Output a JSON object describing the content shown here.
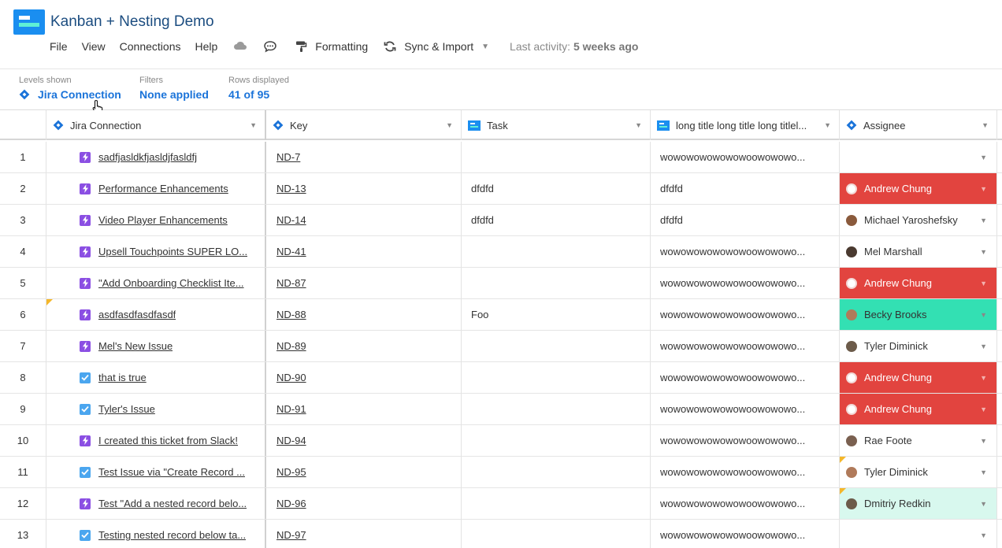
{
  "app": {
    "title": "Kanban + Nesting Demo",
    "brand_color": "#1a8ef0"
  },
  "menu": {
    "items": [
      {
        "label": "File"
      },
      {
        "label": "View"
      },
      {
        "label": "Connections"
      },
      {
        "label": "Help"
      }
    ],
    "icons": [
      "cloud-icon",
      "chat-icon"
    ],
    "formatting_label": "Formatting",
    "sync_label": "Sync & Import",
    "last_activity_label": "Last activity:",
    "last_activity_value": "5 weeks ago"
  },
  "levels": {
    "levels_caption": "Levels shown",
    "levels_value": "Jira Connection",
    "filters_caption": "Filters",
    "filters_value": "None applied",
    "rows_caption": "Rows displayed",
    "rows_value": "41 of 95"
  },
  "columns": [
    {
      "label": "Jira Connection",
      "icon": "jira-diamond-icon"
    },
    {
      "label": "Key",
      "icon": "jira-diamond-icon"
    },
    {
      "label": "Task",
      "icon": "sheet-icon"
    },
    {
      "label": "long title long title long titlel...",
      "icon": "sheet-icon"
    },
    {
      "label": "Assignee",
      "icon": "jira-diamond-icon"
    }
  ],
  "rows": [
    {
      "num": "1",
      "type": "epic",
      "title": "sadfjasldkfjasldjfasldfj",
      "key": "ND-7",
      "task": "",
      "long": "wowowowowowowoowowowo...",
      "assignee": "",
      "style": "",
      "flag_jira": false,
      "flag_assign": false
    },
    {
      "num": "2",
      "type": "epic",
      "title": "Performance Enhancements",
      "key": "ND-13",
      "task": "dfdfd",
      "long": "dfdfd",
      "assignee": "Andrew Chung",
      "style": "red",
      "flag_jira": false,
      "flag_assign": false
    },
    {
      "num": "3",
      "type": "epic",
      "title": "Video Player Enhancements",
      "key": "ND-14",
      "task": "dfdfd",
      "long": "dfdfd",
      "assignee": "Michael Yaroshefsky",
      "style": "",
      "flag_jira": false,
      "flag_assign": false
    },
    {
      "num": "4",
      "type": "epic",
      "title": "Upsell Touchpoints SUPER LO...",
      "key": "ND-41",
      "task": "",
      "long": "wowowowowowowoowowowo...",
      "assignee": "Mel Marshall",
      "style": "",
      "flag_jira": false,
      "flag_assign": false
    },
    {
      "num": "5",
      "type": "epic",
      "title": "\"Add Onboarding Checklist Ite...",
      "key": "ND-87",
      "task": "",
      "long": "wowowowowowowoowowowo...",
      "assignee": "Andrew Chung",
      "style": "red",
      "flag_jira": false,
      "flag_assign": false
    },
    {
      "num": "6",
      "type": "epic",
      "title": "asdfasdfasdfasdf",
      "key": "ND-88",
      "task": "Foo",
      "long": "wowowowowowowoowowowo...",
      "assignee": "Becky Brooks",
      "style": "teal",
      "flag_jira": true,
      "flag_assign": false
    },
    {
      "num": "7",
      "type": "epic",
      "title": "Mel's New Issue",
      "key": "ND-89",
      "task": "",
      "long": "wowowowowowowoowowowo...",
      "assignee": "Tyler Diminick",
      "style": "",
      "flag_jira": false,
      "flag_assign": false
    },
    {
      "num": "8",
      "type": "task",
      "title": "that is true",
      "key": "ND-90",
      "task": "",
      "long": "wowowowowowowoowowowo...",
      "assignee": "Andrew Chung",
      "style": "red",
      "flag_jira": false,
      "flag_assign": false
    },
    {
      "num": "9",
      "type": "task",
      "title": "Tyler's Issue",
      "key": "ND-91",
      "task": "",
      "long": "wowowowowowowoowowowo...",
      "assignee": "Andrew Chung",
      "style": "red",
      "flag_jira": false,
      "flag_assign": false
    },
    {
      "num": "10",
      "type": "epic",
      "title": "I created this ticket from Slack!",
      "key": "ND-94",
      "task": "",
      "long": "wowowowowowowoowowowo...",
      "assignee": "Rae Foote",
      "style": "",
      "flag_jira": false,
      "flag_assign": false
    },
    {
      "num": "11",
      "type": "task",
      "title": "Test Issue via \"Create Record ...",
      "key": "ND-95",
      "task": "",
      "long": "wowowowowowowoowowowo...",
      "assignee": "Tyler Diminick",
      "style": "",
      "flag_jira": false,
      "flag_assign": true
    },
    {
      "num": "12",
      "type": "epic",
      "title": "Test \"Add a nested record belo...",
      "key": "ND-96",
      "task": "",
      "long": "wowowowowowowoowowowo...",
      "assignee": "Dmitriy Redkin",
      "style": "mint",
      "flag_jira": false,
      "flag_assign": true
    },
    {
      "num": "13",
      "type": "task",
      "title": "Testing nested record below ta...",
      "key": "ND-97",
      "task": "",
      "long": "wowowowowowowoowowowo...",
      "assignee": "",
      "style": "",
      "flag_jira": false,
      "flag_assign": false
    }
  ]
}
